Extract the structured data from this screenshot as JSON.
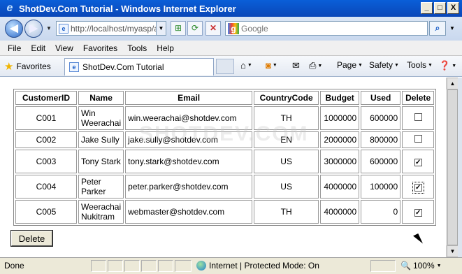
{
  "window": {
    "title": "ShotDev.Com Tutorial - Windows Internet Explorer",
    "buttons": [
      "_",
      "□",
      "X"
    ]
  },
  "address": {
    "url": "http://localhost/myasp/a",
    "search_placeholder": "Google"
  },
  "menu": [
    "File",
    "Edit",
    "View",
    "Favorites",
    "Tools",
    "Help"
  ],
  "favbar": {
    "favorites_label": "Favorites",
    "tab_title": "ShotDev.Com Tutorial"
  },
  "commands": {
    "page": "Page",
    "safety": "Safety",
    "tools": "Tools"
  },
  "table": {
    "headers": [
      "CustomerID",
      "Name",
      "Email",
      "CountryCode",
      "Budget",
      "Used",
      "Delete"
    ],
    "rows": [
      {
        "id": "C001",
        "name": "Win Weerachai",
        "email": "win.weerachai@shotdev.com",
        "country": "TH",
        "budget": "1000000",
        "used": "600000",
        "checked": false
      },
      {
        "id": "C002",
        "name": "Jake Sully",
        "email": "jake.sully@shotdev.com",
        "country": "EN",
        "budget": "2000000",
        "used": "800000",
        "checked": false
      },
      {
        "id": "C003",
        "name": "Tony Stark",
        "email": "tony.stark@shotdev.com",
        "country": "US",
        "budget": "3000000",
        "used": "600000",
        "checked": true
      },
      {
        "id": "C004",
        "name": "Peter Parker",
        "email": "peter.parker@shotdev.com",
        "country": "US",
        "budget": "4000000",
        "used": "100000",
        "checked": true
      },
      {
        "id": "C005",
        "name": "Weerachai Nukitram",
        "email": "webmaster@shotdev.com",
        "country": "TH",
        "budget": "4000000",
        "used": "0",
        "checked": true
      }
    ]
  },
  "delete_button": "Delete",
  "watermark": "SHOTDEV.COM",
  "status": {
    "text": "Done",
    "zone": "Internet | Protected Mode: On",
    "zoom": "100%"
  }
}
